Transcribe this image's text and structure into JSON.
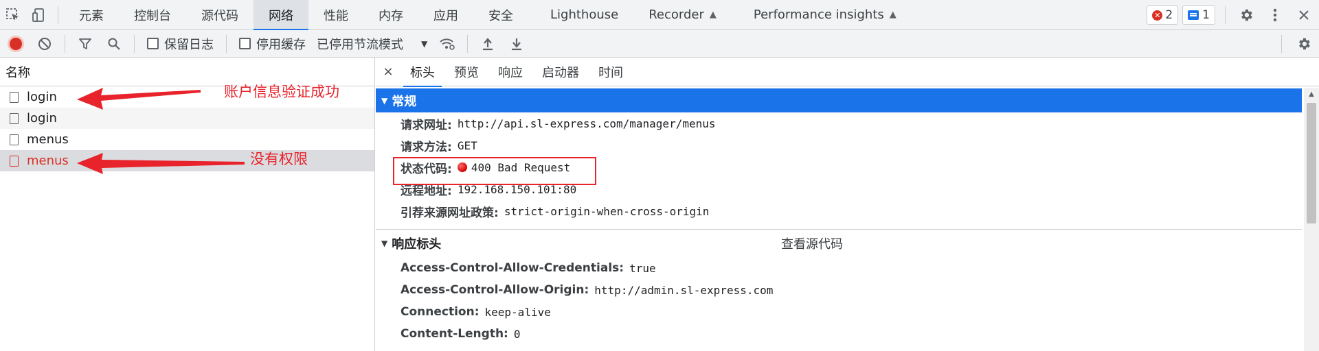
{
  "tabbar": {
    "tabs": [
      {
        "label": "元素"
      },
      {
        "label": "控制台"
      },
      {
        "label": "源代码"
      },
      {
        "label": "网络",
        "active": true
      },
      {
        "label": "性能"
      },
      {
        "label": "内存"
      },
      {
        "label": "应用"
      },
      {
        "label": "安全"
      },
      {
        "label": "Lighthouse"
      },
      {
        "label": "Recorder"
      },
      {
        "label": "Performance insights"
      }
    ],
    "error_count": "2",
    "message_count": "1"
  },
  "toolbar": {
    "preserve_log_label": "保留日志",
    "disable_cache_label": "停用缓存",
    "throttle_label": "已停用节流模式"
  },
  "request_list": {
    "header": "名称",
    "rows": [
      {
        "name": "login"
      },
      {
        "name": "login"
      },
      {
        "name": "menus"
      },
      {
        "name": "menus",
        "selected": true,
        "status": "error"
      }
    ]
  },
  "annotations": {
    "login_note": "账户信息验证成功",
    "menus_note": "没有权限",
    "color": "#e8232b"
  },
  "details": {
    "close_symbol": "×",
    "tabs": [
      "标头",
      "预览",
      "响应",
      "启动器",
      "时间"
    ],
    "general_title": "常规",
    "general": [
      {
        "key": "请求网址:",
        "value": "http://api.sl-express.com/manager/menus"
      },
      {
        "key": "请求方法:",
        "value": "GET"
      },
      {
        "key": "状态代码:",
        "value": "400 Bad Request"
      },
      {
        "key": "远程地址:",
        "value": "192.168.150.101:80"
      },
      {
        "key": "引荐来源网址政策:",
        "value": "strict-origin-when-cross-origin"
      }
    ],
    "response_headers_title": "响应标头",
    "view_source": "查看源代码",
    "response_headers": [
      {
        "key": "Access-Control-Allow-Credentials:",
        "value": "true"
      },
      {
        "key": "Access-Control-Allow-Origin:",
        "value": "http://admin.sl-express.com"
      },
      {
        "key": "Connection:",
        "value": "keep-alive"
      },
      {
        "key": "Content-Length:",
        "value": "0"
      }
    ]
  },
  "colors": {
    "accent": "#1a73e8",
    "error": "#d93025"
  }
}
